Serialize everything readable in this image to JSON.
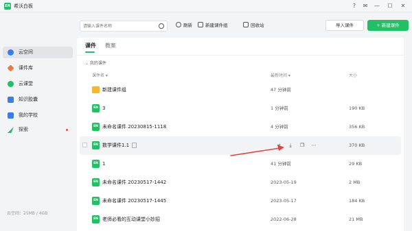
{
  "app": {
    "title": "希沃白板",
    "logo_text": "EN"
  },
  "titlebar_icons": [
    "help-icon",
    "mail-icon",
    "minimize-icon",
    "maximize-icon",
    "close-icon"
  ],
  "sidebar": {
    "items": [
      {
        "label": "云空间",
        "icon": "cloud-icon",
        "color": "#3a7bf0",
        "active": true
      },
      {
        "label": "课件库",
        "icon": "library-icon",
        "color": "#f07a3a"
      },
      {
        "label": "云课堂",
        "icon": "classroom-icon",
        "color": "#21c064"
      },
      {
        "label": "知识胶囊",
        "icon": "capsule-icon",
        "color": "#3a7bf0"
      },
      {
        "label": "我的学校",
        "icon": "school-icon",
        "color": "#3a7bf0"
      },
      {
        "label": "探索",
        "icon": "explore-icon",
        "color": "#21c064",
        "badge": true
      }
    ],
    "storage": "云空间：25MB / 4GB"
  },
  "toolbar": {
    "search_placeholder": "请输入课件名称",
    "refresh": "刷新",
    "new_group": "新建课件组",
    "recycle": "回收站",
    "import": "导入课件",
    "new_courseware": "+ 新建课件"
  },
  "tabs": [
    "课件",
    "教案"
  ],
  "breadcrumb": "我的课件",
  "columns": {
    "name": "课件名",
    "modified": "最新时间",
    "size": "大小"
  },
  "rows": [
    {
      "name": "新建课件组",
      "time": "47 分钟前",
      "size": "",
      "type": "folder"
    },
    {
      "name": "3",
      "time": "1 分钟前",
      "size": "190 KB",
      "type": "file"
    },
    {
      "name": "未命名课件 20230815-1118",
      "time": "4 分钟前",
      "size": "356 KB",
      "type": "file"
    },
    {
      "name": "数学课件1.1",
      "time": "",
      "size": "370 KB",
      "type": "file",
      "hover": true
    },
    {
      "name": "1",
      "time": "41 分钟前",
      "size": "29 KB",
      "type": "file"
    },
    {
      "name": "未命名课件 20230517-1442",
      "time": "2023-05-19",
      "size": "2 MB",
      "type": "file"
    },
    {
      "name": "未命名课件 20230517-1445",
      "time": "2023-05-17",
      "size": "184 KB",
      "type": "file"
    },
    {
      "name": "老师必看的互动课堂小妙招",
      "time": "2022-06-28",
      "size": "21 MB",
      "type": "file"
    }
  ],
  "colors": {
    "accent": "#21c064",
    "arrow": "#e0443a"
  }
}
